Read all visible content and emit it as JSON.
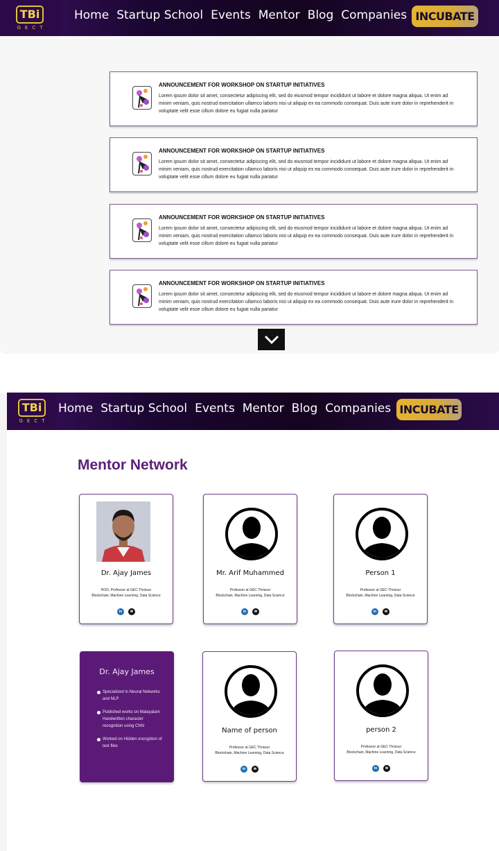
{
  "nav": {
    "logo_main": "TBi",
    "logo_sub": "GECT",
    "items": [
      {
        "label": "Home"
      },
      {
        "label": "Startup School"
      },
      {
        "label": "Events"
      },
      {
        "label": "Mentor"
      },
      {
        "label": "Blog"
      },
      {
        "label": "Companies"
      }
    ],
    "cta": "INCUBATE"
  },
  "announcements": [
    {
      "title": "ANNOUNCEMENT FOR WORKSHOP ON STARTUP INITIATIVES",
      "text": "Lorem ipsum dolor sit amet, consectetur adipiscing elit, sed do eiusmod tempor incididunt ut labore et dolore magna aliqua. Ut enim ad minim veniam, quis nostrud exercitation ullamco laboris nisi ut aliquip ex ea commodo consequat. Duis aute irure dolor in reprehenderit in voluptate velit esse cillum dolore eu fugiat nulla pariatur"
    },
    {
      "title": "ANNOUNCEMENT FOR WORKSHOP ON STARTUP INITIATIVES",
      "text": "Lorem ipsum dolor sit amet, consectetur adipiscing elit, sed do eiusmod tempor incididunt ut labore et dolore magna aliqua. Ut enim ad minim veniam, quis nostrud exercitation ullamco laboris nisi ut aliquip ex ea commodo consequat. Duis aute irure dolor in reprehenderit in voluptate velit esse cillum dolore eu fugiat nulla pariatur"
    },
    {
      "title": "ANNOUNCEMENT FOR WORKSHOP ON STARTUP INITIATIVES",
      "text": "Lorem ipsum dolor sit amet, consectetur adipiscing elit, sed do eiusmod tempor incididunt ut labore et dolore magna aliqua. Ut enim ad minim veniam, quis nostrud exercitation ullamco laboris nisi ut aliquip ex ea commodo consequat. Duis aute irure dolor in reprehenderit in voluptate velit esse cillum dolore eu fugiat nulla pariatur"
    },
    {
      "title": "ANNOUNCEMENT FOR WORKSHOP ON STARTUP INITIATIVES",
      "text": "Lorem ipsum dolor sit amet, consectetur adipiscing elit, sed do eiusmod tempor incididunt ut labore et dolore magna aliqua. Ut enim ad minim veniam, quis nostrud exercitation ullamco laboris nisi ut aliquip ex ea commodo consequat. Duis aute irure dolor in reprehenderit in voluptate velit esse cillum dolore eu fugiat nulla pariatur"
    }
  ],
  "mentor_section": {
    "title": "Mentor Network",
    "cards": [
      {
        "name": "Dr. Ajay James",
        "role": "HOD, Professor at GEC Thrissur",
        "skills": "Blockchain, Machine Learning, Data Science"
      },
      {
        "name": "Mr. Arif Muhammed",
        "role": "Professor at GEC Thrissur",
        "skills": "Blockchain, Machine Learning, Data Science"
      },
      {
        "name": "Person 1",
        "role": "Professor at GEC Thrissur",
        "skills": "Blockchain, Machine Learning, Data Science"
      },
      {
        "name": "Name of person",
        "role": "Professor at GEC Thrissur",
        "skills": "Blockchain, Machine Learning, Data Science"
      },
      {
        "name": "person 2",
        "role": "Professor at GEC Thrissur",
        "skills": "Blockchain, Machine Learning, Data Science"
      }
    ],
    "highlight": {
      "name": "Dr. Ajay James",
      "points": [
        "Specialized in Neural Networks and NLP",
        "Published works on Malayalam Handwritten character recognition using CNN",
        "Worked on Hidden encryption of text files"
      ]
    },
    "social": {
      "linkedin": "in",
      "mail": "✉"
    }
  },
  "colors": {
    "brand_purple": "#5c1a78",
    "accent_gold": "#e5b431",
    "nav_dark": "#14041f"
  }
}
